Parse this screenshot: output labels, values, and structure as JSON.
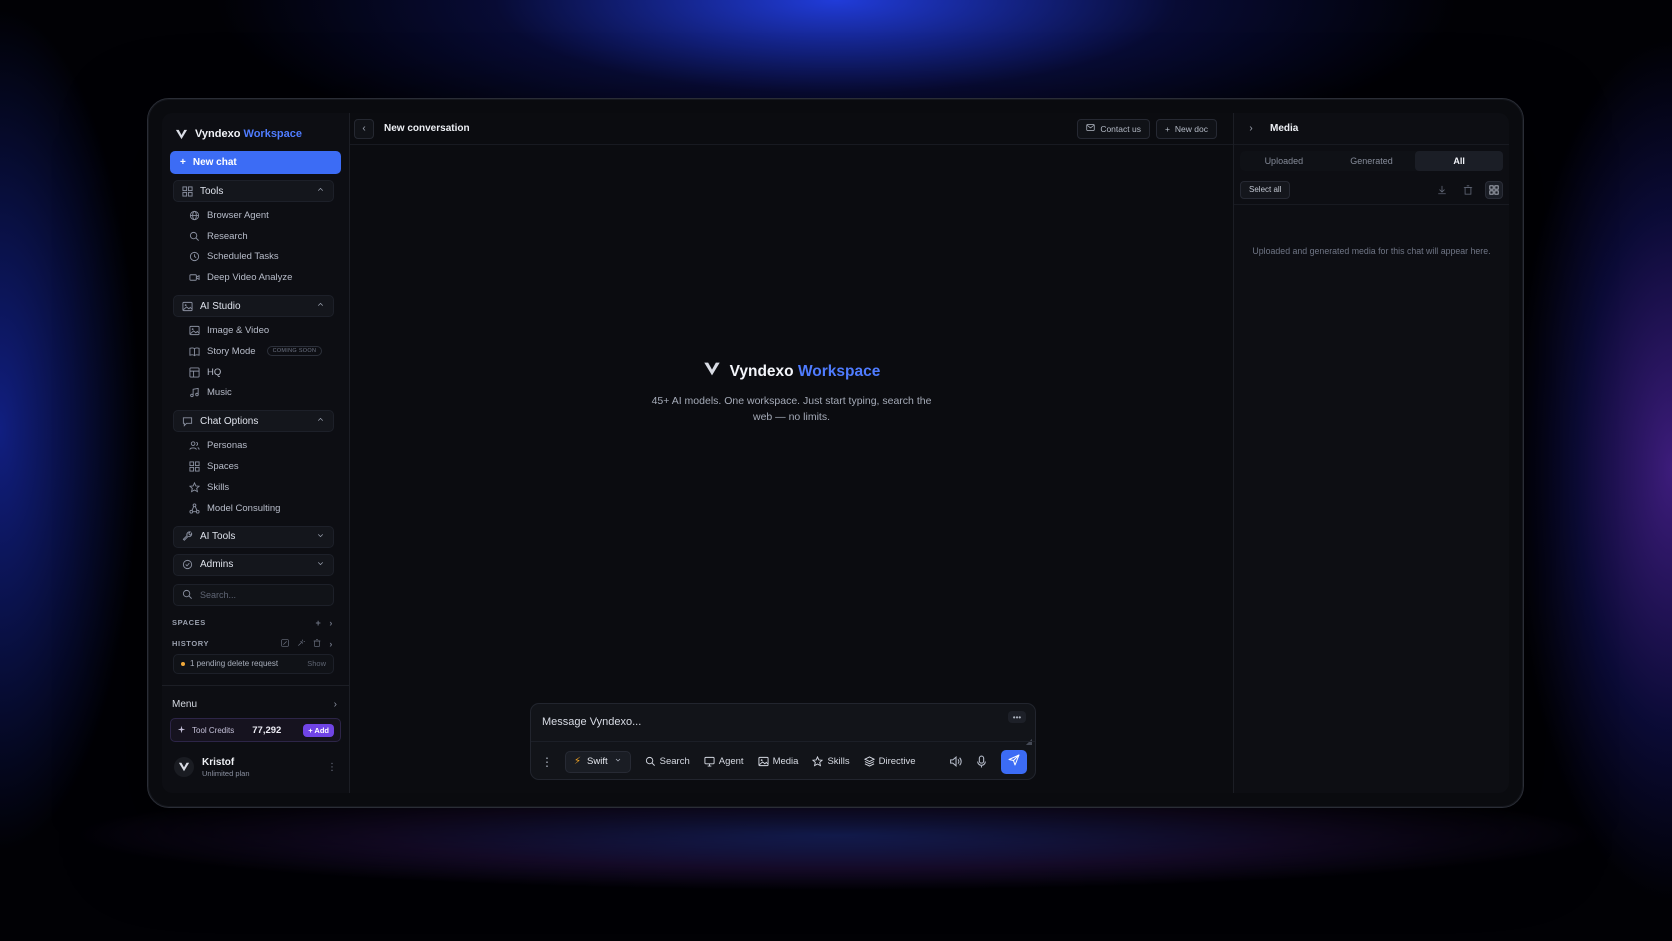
{
  "brand": {
    "name": "Vyndexo",
    "accent": "Workspace"
  },
  "sidebar": {
    "new_chat": "New chat",
    "groups": [
      {
        "label": "Tools",
        "icon": "grid-icon",
        "expanded": true,
        "items": [
          {
            "label": "Browser Agent",
            "icon": "globe-icon"
          },
          {
            "label": "Research",
            "icon": "search-icon"
          },
          {
            "label": "Scheduled Tasks",
            "icon": "clock-icon"
          },
          {
            "label": "Deep Video Analyze",
            "icon": "video-icon"
          }
        ]
      },
      {
        "label": "AI Studio",
        "icon": "image-icon",
        "expanded": true,
        "items": [
          {
            "label": "Image & Video",
            "icon": "image-icon"
          },
          {
            "label": "Story Mode",
            "icon": "book-icon",
            "badge": "COMING SOON"
          },
          {
            "label": "HQ",
            "icon": "layout-icon"
          },
          {
            "label": "Music",
            "icon": "music-icon"
          }
        ]
      },
      {
        "label": "Chat Options",
        "icon": "chat-icon",
        "expanded": true,
        "items": [
          {
            "label": "Personas",
            "icon": "users-icon"
          },
          {
            "label": "Spaces",
            "icon": "grid-icon"
          },
          {
            "label": "Skills",
            "icon": "star-icon"
          },
          {
            "label": "Model Consulting",
            "icon": "nodes-icon"
          }
        ]
      },
      {
        "label": "AI Tools",
        "icon": "wrench-icon",
        "expanded": false
      },
      {
        "label": "Admins",
        "icon": "shield-icon",
        "expanded": false
      }
    ],
    "search_placeholder": "Search...",
    "spaces_label": "SPACES",
    "history_label": "HISTORY",
    "pending": {
      "text": "1 pending delete request",
      "action": "Show"
    },
    "menu_label": "Menu",
    "credits": {
      "label": "Tool Credits",
      "value": "77,292",
      "add": "+ Add"
    },
    "user": {
      "name": "Kristof",
      "plan": "Unlimited plan"
    }
  },
  "topbar": {
    "title": "New conversation",
    "contact": "Contact us",
    "new_doc": "New doc"
  },
  "hero": {
    "title": "Vyndexo",
    "accent": "Workspace",
    "subtitle": "45+ AI models. One workspace. Just start typing, search the web — no limits."
  },
  "composer": {
    "placeholder": "Message Vyndexo...",
    "model": "Swift",
    "tools": [
      "Search",
      "Agent",
      "Media",
      "Skills",
      "Directive"
    ]
  },
  "media": {
    "title": "Media",
    "tabs": [
      "Uploaded",
      "Generated",
      "All"
    ],
    "active_tab": "All",
    "select_all": "Select all",
    "empty": "Uploaded and generated media for this chat will appear here."
  },
  "colors": {
    "accent": "#3c6cf5",
    "brand_accent": "#4f7cff",
    "credits_add": "#7044e6"
  }
}
